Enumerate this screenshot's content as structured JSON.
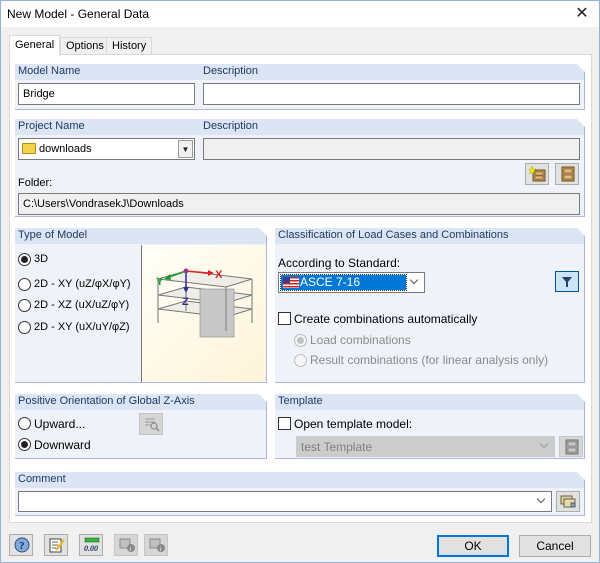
{
  "window": {
    "title": "New Model - General Data",
    "close_icon": "close-icon"
  },
  "tabs": [
    {
      "label": "General",
      "active": true
    },
    {
      "label": "Options",
      "active": false
    },
    {
      "label": "History",
      "active": false
    }
  ],
  "model_section": {
    "model_name_label": "Model Name",
    "model_name_value": "Bridge",
    "description_label": "Description",
    "description_value": ""
  },
  "project_section": {
    "project_name_label": "Project Name",
    "project_name_value": "downloads",
    "project_icon": "folder-icon",
    "description_label": "Description",
    "description_value": "",
    "folder_label": "Folder:",
    "folder_value": "C:\\Users\\VondrasekJ\\Downloads",
    "new_project_icon": "new-project-cabinet-icon",
    "manage_projects_icon": "project-manager-cabinet-icon"
  },
  "type_of_model": {
    "title": "Type of Model",
    "options": [
      {
        "label": "3D",
        "checked": true
      },
      {
        "label": "2D - XY (uZ/φX/φY)",
        "checked": false
      },
      {
        "label": "2D - XZ (uX/uZ/φY)",
        "checked": false
      },
      {
        "label": "2D - XY (uX/uY/φZ)",
        "checked": false
      }
    ],
    "illustration": {
      "axis_x": "X",
      "axis_y": "Y",
      "axis_z": "Z"
    }
  },
  "classification": {
    "title": "Classification of Load Cases and Combinations",
    "standard_label": "According to Standard:",
    "standard_value": "ASCE 7-16",
    "standard_flag": "us-flag-icon",
    "filter_icon": "filter-icon",
    "create_combinations_label": "Create combinations automatically",
    "create_combinations_checked": false,
    "sub_options": [
      {
        "label": "Load combinations",
        "checked": true,
        "enabled": false
      },
      {
        "label": "Result combinations (for linear analysis only)",
        "checked": false,
        "enabled": false
      }
    ]
  },
  "z_axis": {
    "title": "Positive Orientation of Global Z-Axis",
    "options": [
      {
        "label": "Upward...",
        "checked": false
      },
      {
        "label": "Downward",
        "checked": true
      }
    ],
    "view_icon": "view-details-icon"
  },
  "template": {
    "title": "Template",
    "open_template_label": "Open template model:",
    "open_template_checked": false,
    "template_value": "test Template"
  },
  "comment": {
    "title": "Comment",
    "value": ""
  },
  "footer": {
    "ok_label": "OK",
    "cancel_label": "Cancel",
    "tool_icons": [
      "help-icon",
      "edit-icon",
      "units-icon",
      "import-info-icon",
      "export-info-icon"
    ]
  },
  "colors": {
    "group_header": "#dce5f3",
    "group_body": "#eff3f9",
    "selection": "#0078d7",
    "default_button_border": "#0078d7"
  }
}
